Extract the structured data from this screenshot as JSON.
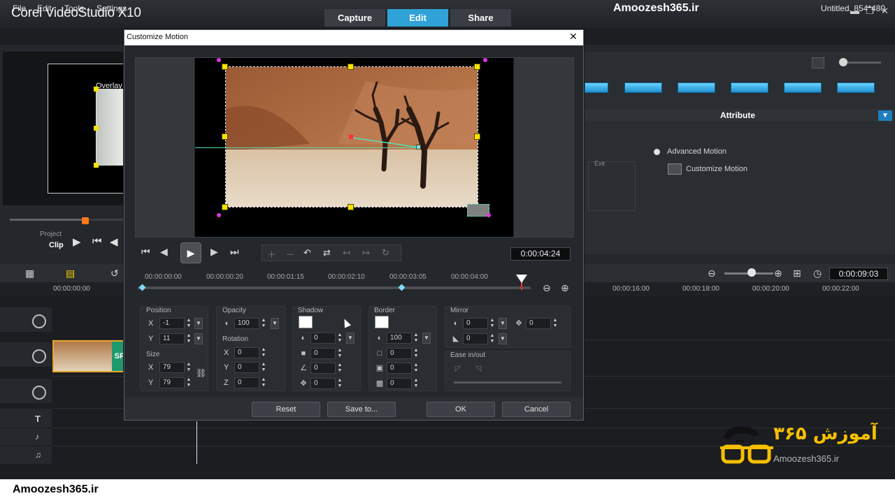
{
  "app": {
    "logo": "Corel VideoStudio X10",
    "tabs": [
      "Capture",
      "Edit",
      "Share"
    ],
    "active_tab": "Edit",
    "watermark_top": "Amoozesh365.ir",
    "window_controls": [
      "minimize-icon",
      "restore-icon",
      "close-icon"
    ]
  },
  "menu": {
    "items": [
      "File",
      "Edit",
      "Tools",
      "Settings"
    ],
    "project_info": "Untitled, 854*480"
  },
  "player": {
    "overlay_label": "Overlay",
    "project_label": "Project",
    "clip_label": "Clip",
    "scrub_position": 0.64
  },
  "library": {
    "attribute_title": "Attribute",
    "exit_label": "Exit",
    "advanced_motion": "Advanced Motion",
    "customize_motion": "Customize Motion"
  },
  "timeline": {
    "timecode": "0:00:09:03",
    "start_time": "00:00:00:00",
    "ruler_ticks": [
      "00:00:16:00",
      "00:00:18:00",
      "00:00:20:00",
      "00:00:22:00"
    ],
    "clip_label": "SP"
  },
  "dialog": {
    "title": "Customize Motion",
    "timecode": "0:00:04:24",
    "ruler_ticks": [
      "00:00:00:00",
      "00:00:00:20",
      "00:00:01:15",
      "00:00:02:10",
      "00:00:03:05",
      "00:00:04:00"
    ],
    "position": {
      "title": "Position",
      "x_label": "X",
      "x": "-1",
      "y_label": "Y",
      "y": "11"
    },
    "size": {
      "title": "Size",
      "x_label": "X",
      "x": "79",
      "y_label": "Y",
      "y": "79"
    },
    "opacity": {
      "title": "Opacity",
      "value": "100"
    },
    "rotation": {
      "title": "Rotation",
      "x_label": "X",
      "x": "0",
      "y_label": "Y",
      "y": "0",
      "z_label": "Z",
      "z": "0"
    },
    "shadow": {
      "title": "Shadow",
      "v1": "0",
      "v2": "0",
      "v3": "0",
      "v4": "0",
      "color": "#ffffff"
    },
    "border": {
      "title": "Border",
      "v1": "100",
      "v2": "0",
      "v3": "0",
      "v4": "0",
      "color": "#ffffff"
    },
    "mirror": {
      "title": "Mirror",
      "v1": "0",
      "v2": "0",
      "v3": "0"
    },
    "ease": {
      "title": "Ease in/out"
    },
    "buttons": {
      "reset": "Reset",
      "save_to": "Save to...",
      "ok": "OK",
      "cancel": "Cancel"
    }
  },
  "brand": {
    "persian": "آموزش ۳۶۵",
    "latin": "Amoozesh365.ir"
  },
  "bottom_watermark": "Amoozesh365.ir",
  "colors": {
    "accent": "#2fa3d8",
    "handle": "#ffe100",
    "brand_yellow": "#f6c000"
  }
}
